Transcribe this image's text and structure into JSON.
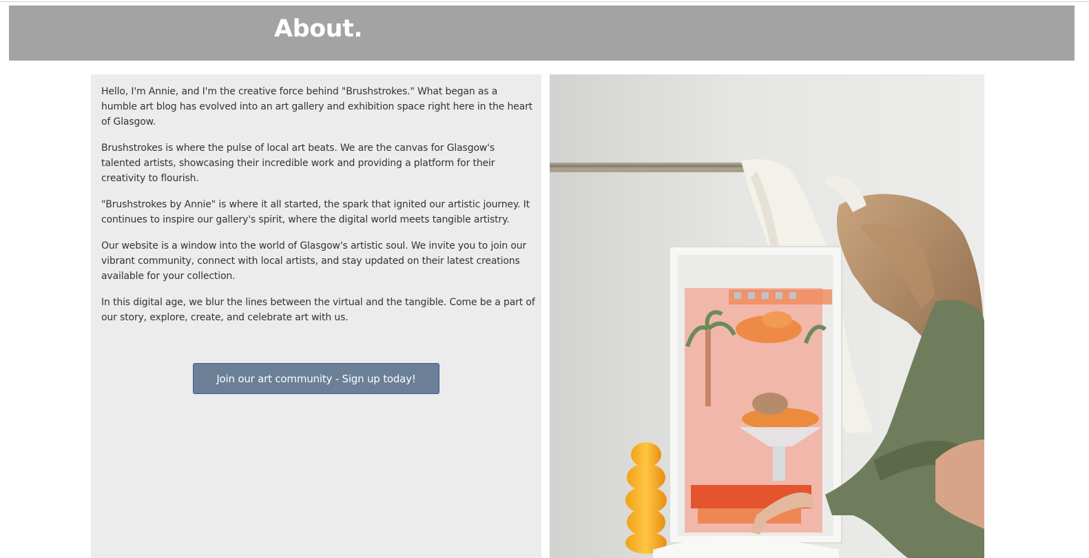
{
  "header": {
    "title": "About."
  },
  "about": {
    "paragraphs": [
      "Hello, I'm Annie, and I'm the creative force behind \"Brushstrokes.\" What began as a humble art blog has evolved into an art gallery and exhibition space right here in the heart of Glasgow.",
      "Brushstrokes is where the pulse of local art beats. We are the canvas for Glasgow's talented artists, showcasing their incredible work and providing a platform for their creativity to flourish.",
      "\"Brushstrokes by Annie\" is where it all started, the spark that ignited our artistic journey. It continues to inspire our gallery's spirit, where the digital world meets tangible artistry.",
      "Our website is a window into the world of Glasgow's artistic soul. We invite you to join our vibrant community, connect with local artists, and stay updated on their latest creations available for your collection.",
      "In this digital age, we blur the lines between the virtual and the tangible. Come be a part of our story, explore, create, and celebrate art with us."
    ],
    "cta_label": "Join our art community - Sign up today!"
  },
  "colors": {
    "header_bg": "#a3a3a3",
    "panel_bg": "#ececec",
    "button_bg": "#6b7f97",
    "button_border": "#2f5d9c"
  }
}
